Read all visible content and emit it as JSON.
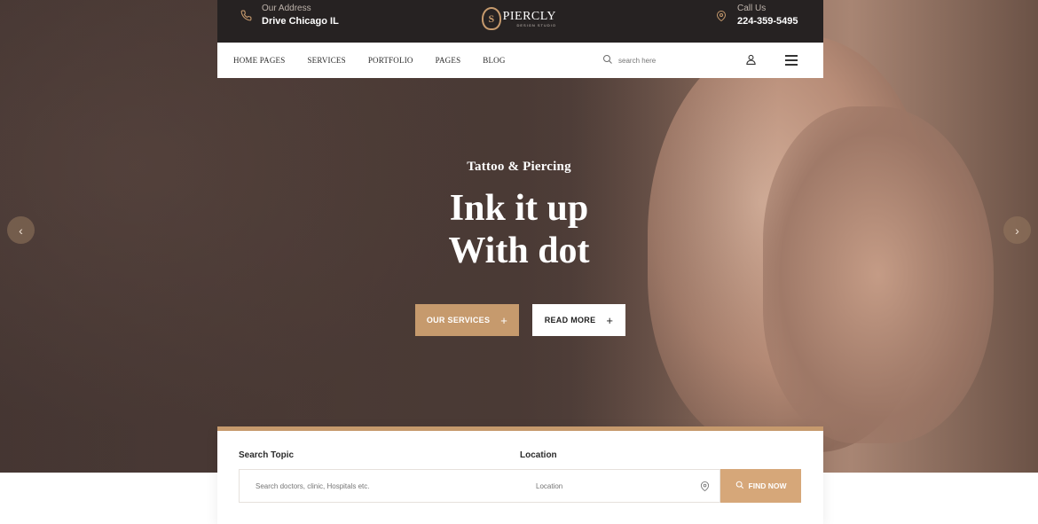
{
  "topbar": {
    "address_label": "Our Address",
    "address_value": "Drive Chicago IL",
    "call_label": "Call Us",
    "call_value": "224-359-5495",
    "logo_text": "PIERCLY",
    "logo_sub": "DESIGN STUDIO"
  },
  "nav": {
    "items": [
      {
        "label": "HOME PAGES"
      },
      {
        "label": "SERVICES"
      },
      {
        "label": "PORTFOLIO"
      },
      {
        "label": "PAGES"
      },
      {
        "label": "BLOG"
      }
    ],
    "search_placeholder": "search here"
  },
  "hero": {
    "eyebrow": "Tattoo & Piercing",
    "headline_line1": "Ink it up",
    "headline_line2": "With dot",
    "primary_button": "OUR SERVICES",
    "secondary_button": "READ MORE"
  },
  "search_panel": {
    "topic_label": "Search Topic",
    "topic_placeholder": "Search doctors, clinic, Hospitals etc.",
    "location_label": "Location",
    "location_placeholder": "Location",
    "find_button": "FIND NOW"
  },
  "colors": {
    "accent": "#c69a6d",
    "topbar_bg": "#262222"
  },
  "icons": [
    "phone-icon",
    "map-pin-icon",
    "search-icon",
    "user-icon",
    "menu-icon",
    "plus-icon",
    "chevron-left-icon",
    "chevron-right-icon"
  ]
}
